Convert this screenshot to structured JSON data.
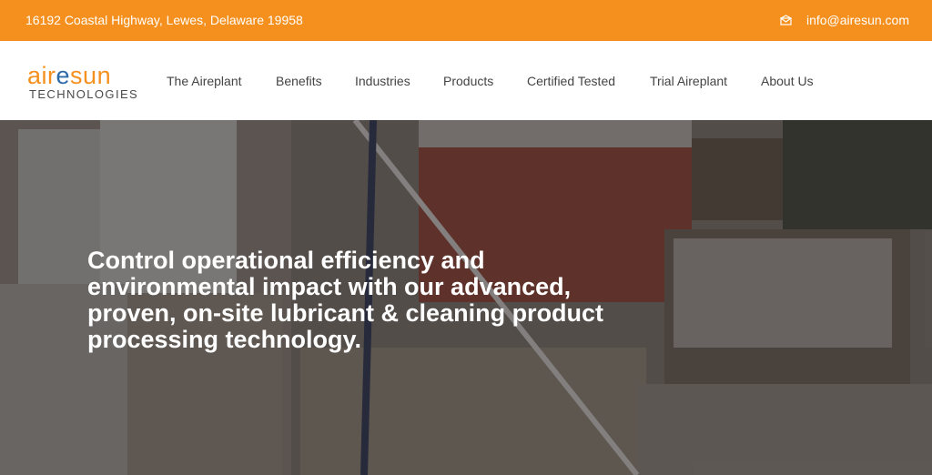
{
  "topbar": {
    "address": "16192 Coastal Highway, Lewes, Delaware 19958",
    "email": "info@airesun.com",
    "icon": "envelope-icon"
  },
  "logo": {
    "word_left": "air",
    "word_mid": "e",
    "word_right": "sun",
    "subtitle": "TECHNOLOGIES"
  },
  "nav": {
    "items": [
      {
        "label": "The Aireplant"
      },
      {
        "label": "Benefits"
      },
      {
        "label": "Industries"
      },
      {
        "label": "Products"
      },
      {
        "label": "Certified Tested"
      },
      {
        "label": "Trial Aireplant"
      },
      {
        "label": "About Us"
      }
    ]
  },
  "hero": {
    "headline": "Control operational efficiency and environmental impact with our advanced, proven, on-site lubricant & cleaning product processing technology."
  },
  "colors": {
    "accent": "#f5901e",
    "brand_blue": "#2d6aa8"
  }
}
